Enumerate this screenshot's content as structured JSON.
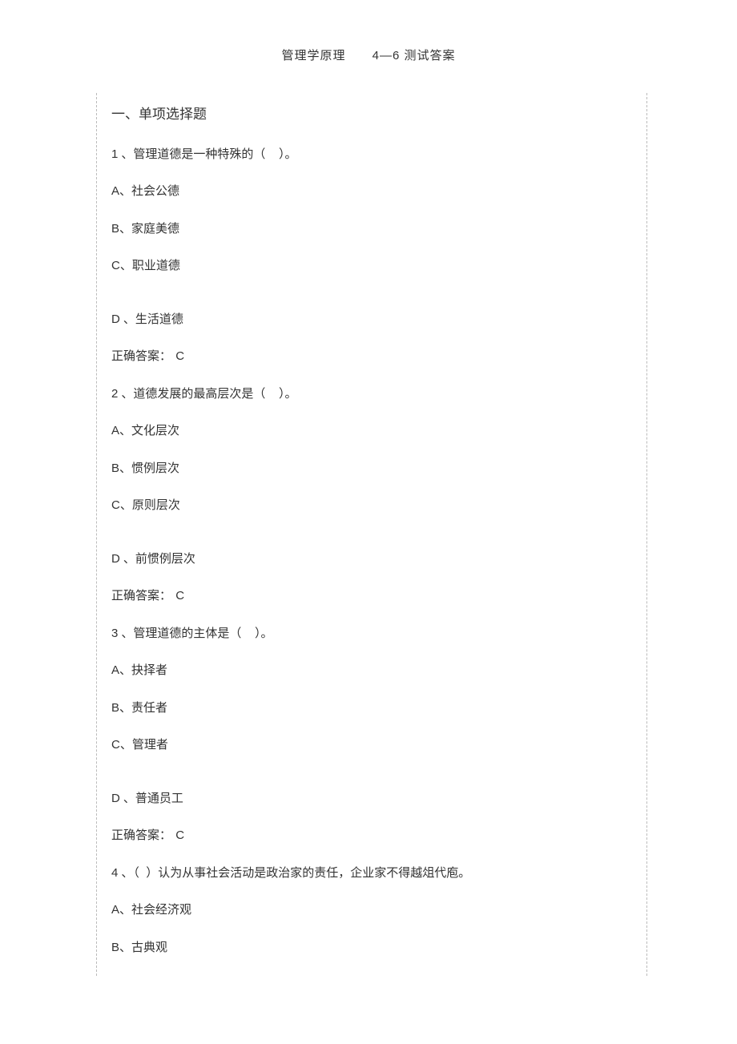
{
  "header": {
    "title_main": "管理学原理",
    "title_sub": "4—6 测试答案"
  },
  "section": {
    "title": "一、单项选择题"
  },
  "questions": [
    {
      "num": "1",
      "stem_before": "、管理道德是一种特殊的（",
      "stem_after": "）。",
      "options": {
        "A": "、社会公德",
        "B": "、家庭美德",
        "C": "、职业道德",
        "D": "、生活道德"
      },
      "answer_label": " 正确答案：",
      "answer_value": "C"
    },
    {
      "num": "2",
      "stem_before": "、道德发展的最高层次是（",
      "stem_after": "）。",
      "options": {
        "A": "、文化层次",
        "B": "、惯例层次",
        "C": "、原则层次",
        "D": "、前惯例层次"
      },
      "answer_label": "正确答案：",
      "answer_value": "C"
    },
    {
      "num": "3",
      "stem_before": "、管理道德的主体是（",
      "stem_after": "）。",
      "options": {
        "A": "、抉择者",
        "B": "、责任者",
        "C": "、管理者",
        "D": "、普通员工"
      },
      "answer_label": " 正确答案：",
      "answer_value": "C"
    },
    {
      "num": "4",
      "stem_before": "、（",
      "stem_after": "）认为从事社会活动是政治家的责任，企业家不得越俎代庖。",
      "options": {
        "A": "、社会经济观",
        "B": "、古典观"
      },
      "answer_label": "",
      "answer_value": ""
    }
  ]
}
